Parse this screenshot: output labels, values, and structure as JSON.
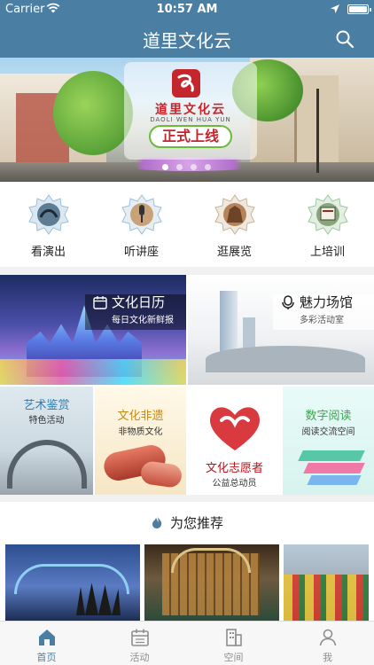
{
  "status_bar": {
    "carrier": "Carrier",
    "time": "10:57 AM"
  },
  "nav": {
    "title": "道里文化云"
  },
  "banner": {
    "logo_name": "道里文化云",
    "logo_pinyin": "DAOLI WEN HUA YUN",
    "slogan": "正式上线",
    "page_count": 4,
    "active_page": 1
  },
  "quick_entries": [
    {
      "label": "看演出",
      "icon": "performance-icon"
    },
    {
      "label": "听讲座",
      "icon": "lecture-icon"
    },
    {
      "label": "逛展览",
      "icon": "exhibition-icon"
    },
    {
      "label": "上培训",
      "icon": "training-icon"
    }
  ],
  "features": {
    "calendar": {
      "title": "文化日历",
      "subtitle": "每日文化新鲜报",
      "icon": "calendar-icon"
    },
    "venues": {
      "title": "魅力场馆",
      "subtitle": "多彩活动室",
      "icon": "venue-icon"
    },
    "art": {
      "title": "艺术鉴赏",
      "subtitle": "特色活动"
    },
    "heritage": {
      "title": "文化非遗",
      "subtitle": "非物质文化"
    },
    "volunteer": {
      "title": "文化志愿者",
      "subtitle": "公益总动员"
    },
    "reading": {
      "title": "数字阅读",
      "subtitle": "阅读交流空间"
    }
  },
  "recommend": {
    "title": "为您推荐"
  },
  "tabs": [
    {
      "label": "首页",
      "icon": "home-icon",
      "active": true
    },
    {
      "label": "活动",
      "icon": "calendar-icon",
      "active": false
    },
    {
      "label": "空间",
      "icon": "building-icon",
      "active": false
    },
    {
      "label": "我",
      "icon": "profile-icon",
      "active": false
    }
  ],
  "colors": {
    "brand": "#4a7fa3",
    "accent_red": "#c4262e",
    "tab_inactive": "#8e8e8e"
  }
}
